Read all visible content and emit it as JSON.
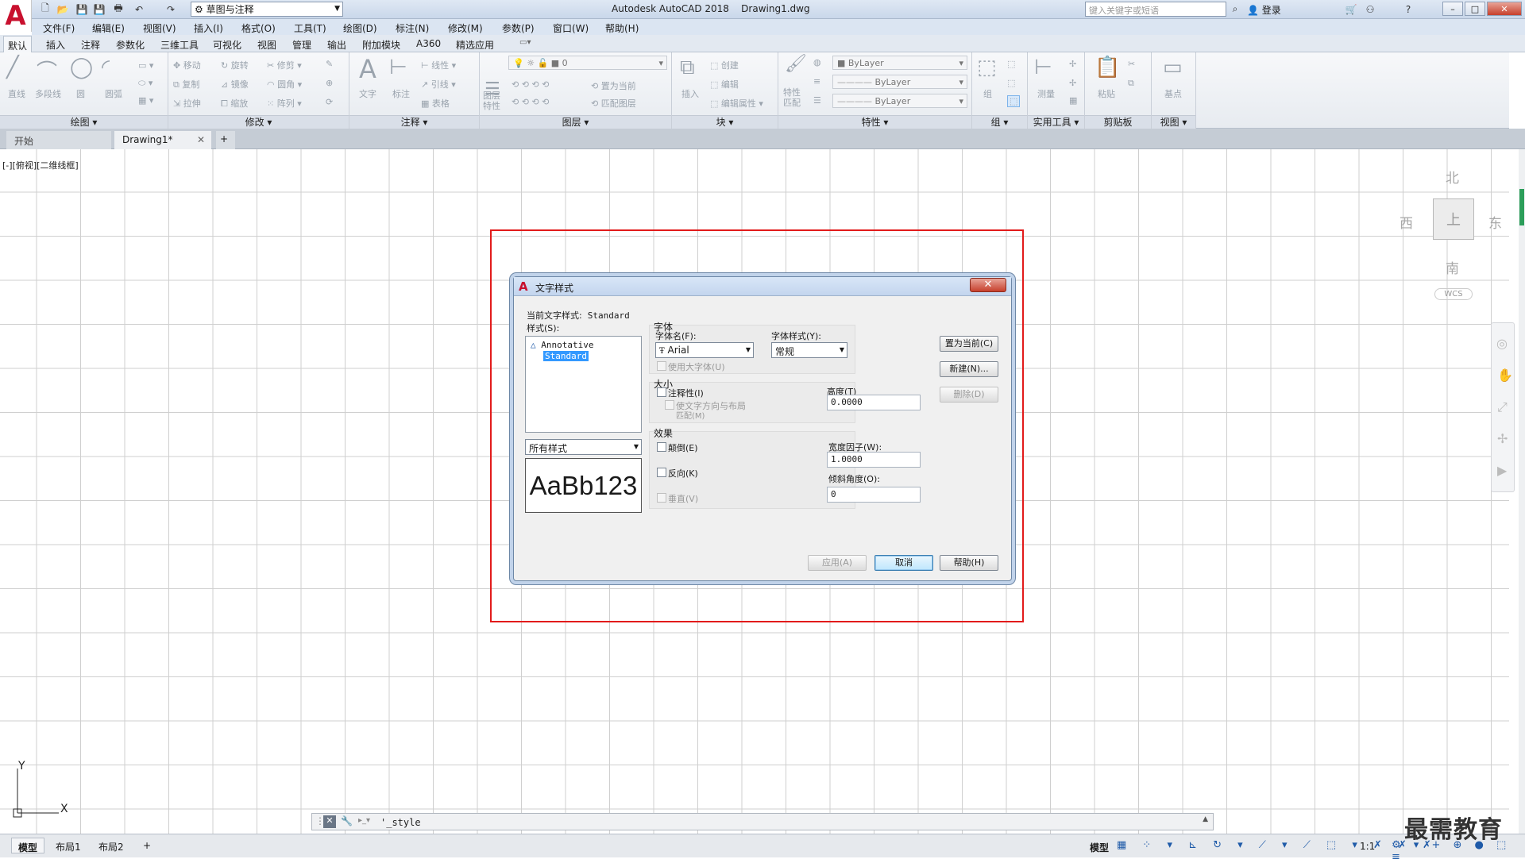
{
  "app": {
    "title": "Autodesk AutoCAD 2018    Drawing1.dwg",
    "workspace": "草图与注释",
    "search_placeholder": "键入关键字或短语",
    "login": "登录"
  },
  "menu": [
    "文件(F)",
    "编辑(E)",
    "视图(V)",
    "插入(I)",
    "格式(O)",
    "工具(T)",
    "绘图(D)",
    "标注(N)",
    "修改(M)",
    "参数(P)",
    "窗口(W)",
    "帮助(H)"
  ],
  "ribbon_tabs": [
    "默认",
    "插入",
    "注释",
    "参数化",
    "三维工具",
    "可视化",
    "视图",
    "管理",
    "输出",
    "附加模块",
    "A360",
    "精选应用"
  ],
  "ribbon": {
    "draw": {
      "label": "绘图",
      "tools": [
        "直线",
        "多段线",
        "圆",
        "圆弧"
      ]
    },
    "modify": {
      "label": "修改",
      "tools": [
        "移动",
        "旋转",
        "修剪",
        "复制",
        "镜像",
        "圆角",
        "拉伸",
        "缩放",
        "阵列"
      ]
    },
    "annotate": {
      "label": "注释",
      "tools": [
        "文字",
        "标注",
        "线性",
        "引线",
        "表格"
      ]
    },
    "layers": {
      "label": "图层",
      "tools": [
        "图层特性",
        "置为当前",
        "匹配图层"
      ],
      "current": "0"
    },
    "block": {
      "label": "块",
      "tools": [
        "插入",
        "创建",
        "编辑",
        "编辑属性"
      ]
    },
    "properties": {
      "label": "特性",
      "match": "特性匹配",
      "color": "ByLayer",
      "linetype": "ByLayer",
      "lineweight": "ByLayer"
    },
    "groups": {
      "label": "组",
      "tools": [
        "组"
      ]
    },
    "utilities": {
      "label": "实用工具",
      "tools": [
        "测量"
      ]
    },
    "clipboard": {
      "label": "剪贴板",
      "tools": [
        "粘贴"
      ]
    },
    "view": {
      "label": "视图",
      "tools": [
        "基点"
      ]
    }
  },
  "doc_tabs": [
    "开始",
    "Drawing1*"
  ],
  "viewport_label": "[-][俯视][二维线框]",
  "viewcube": {
    "north": "北",
    "south": "南",
    "east": "东",
    "west": "西",
    "face": "上",
    "wcs": "WCS"
  },
  "ucs": {
    "x": "X",
    "y": "Y"
  },
  "command_line": "'_style",
  "layout_tabs": [
    "模型",
    "布局1",
    "布局2"
  ],
  "status": {
    "model": "模型",
    "scale": "1:1"
  },
  "watermark": "最需教育",
  "dialog": {
    "title": "文字样式",
    "current_label": "当前文字样式:",
    "current_value": "Standard",
    "styles_label": "样式(S):",
    "styles": [
      "Annotative",
      "Standard"
    ],
    "selected_style": "Standard",
    "filter": "所有样式",
    "preview": "AaBb123",
    "font_group": "字体",
    "font_name_label": "字体名(F):",
    "font_name": "Arial",
    "font_style_label": "字体样式(Y):",
    "font_style": "常规",
    "use_bigfont": "使用大字体(U)",
    "size_group": "大小",
    "annotative": "注释性(I)",
    "match_orientation": "使文字方向与布局",
    "match_orientation2": "匹配(M)",
    "height_label": "高度(T)",
    "height": "0.0000",
    "effects_group": "效果",
    "upside_down": "颠倒(E)",
    "backwards": "反向(K)",
    "vertical": "垂直(V)",
    "width_label": "宽度因子(W):",
    "width": "1.0000",
    "oblique_label": "倾斜角度(O):",
    "oblique": "0",
    "btn_set_current": "置为当前(C)",
    "btn_new": "新建(N)...",
    "btn_delete": "删除(D)",
    "btn_apply": "应用(A)",
    "btn_cancel": "取消",
    "btn_help": "帮助(H)"
  }
}
